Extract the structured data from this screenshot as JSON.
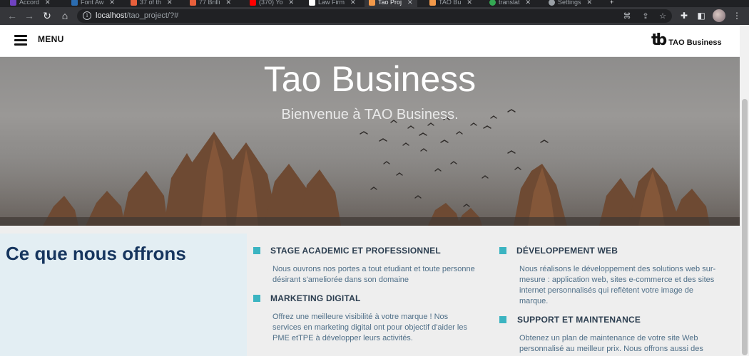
{
  "browser": {
    "tabs": [
      {
        "label": "Accord",
        "color": "#6f42c1"
      },
      {
        "label": "Font Aw",
        "color": "#2b6cb0"
      },
      {
        "label": "37 of th",
        "color": "#e8603c"
      },
      {
        "label": "77 Brilli",
        "color": "#e8603c"
      },
      {
        "label": "(370) Yo",
        "color": "#ff0000"
      },
      {
        "label": "Law Firm",
        "color": "#ffffff"
      },
      {
        "label": "Tao Proj",
        "color": "#f2994a"
      },
      {
        "label": "TAO Bu",
        "color": "#f2994a"
      },
      {
        "label": "translat",
        "color": "#34a853"
      },
      {
        "label": "Settings",
        "color": "#9aa0a6"
      }
    ],
    "url_host": "localhost",
    "url_path": "/tao_project/?#"
  },
  "header": {
    "menu_label": "MENU",
    "logo_mark": "tb",
    "logo_text": "TAO Business"
  },
  "hero": {
    "title": "Tao Business",
    "subtitle": "Bienvenue à TAO Business."
  },
  "offers": {
    "heading": "Ce que nous offrons",
    "services": [
      {
        "title": "STAGE ACADEMIC ET PROFESSIONNEL",
        "lines": [
          "Nous ouvrons nos portes a tout etudiant et toute personne",
          "désirant s'ameliorée dans son domaine"
        ]
      },
      {
        "title": "MARKETING DIGITAL",
        "lines": [
          "Offrez une meilleure visibilité à votre marque ! Nos",
          "services en marketing digital ont pour objectif d'aider les",
          "PME etTPE à développer leurs activités."
        ]
      },
      {
        "title": "DÉVELOPPEMENT WEB",
        "lines": [
          "Nous réalisons le développement des solutions web sur-",
          "mesure : application web, sites e-commerce et des sites",
          "internet personnalisés qui reflètent votre image de",
          "marque."
        ]
      },
      {
        "title": "SUPPORT ET MAINTENANCE",
        "lines": [
          "Obtenez un plan de maintenance de votre site Web",
          "personnalisé au meilleur prix. Nous offrons aussi des"
        ]
      }
    ]
  },
  "colors": {
    "accent": "#3bb4c1",
    "heading": "#16355e",
    "body_text": "#4f6f88"
  }
}
